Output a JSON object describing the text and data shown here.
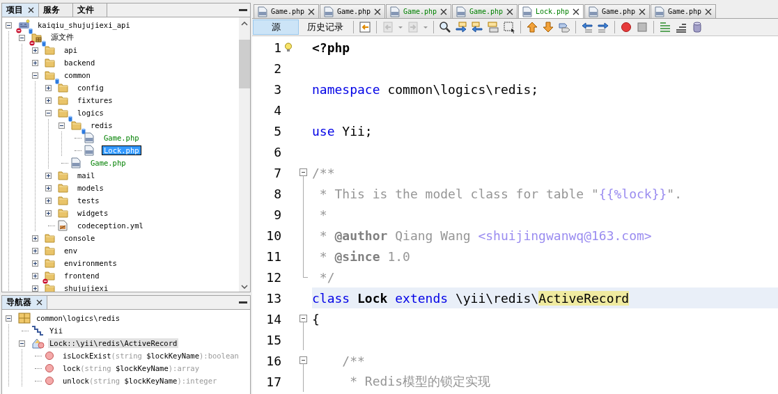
{
  "project_panel": {
    "tabs": [
      {
        "label": "项目",
        "selected": true,
        "closable": true
      },
      {
        "label": "服务",
        "selected": false,
        "closable": false
      },
      {
        "label": "文件",
        "selected": false,
        "closable": false
      }
    ],
    "tree": [
      {
        "name": "kaiqiu_shujujiexi_api",
        "kind": "project",
        "expanded": true,
        "selected": false,
        "error": true,
        "db": true,
        "children": [
          {
            "name": "源文件",
            "kind": "sources",
            "expanded": true,
            "selected": false,
            "error": true,
            "db": true,
            "children": [
              {
                "name": "api",
                "kind": "folder",
                "expanded": false,
                "selected": false,
                "error": false,
                "db": false
              },
              {
                "name": "backend",
                "kind": "folder",
                "expanded": false,
                "selected": false,
                "error": false,
                "db": false
              },
              {
                "name": "common",
                "kind": "folder",
                "expanded": true,
                "selected": false,
                "error": false,
                "db": true,
                "children": [
                  {
                    "name": "config",
                    "kind": "folder",
                    "expanded": false,
                    "selected": false,
                    "error": false,
                    "db": false
                  },
                  {
                    "name": "fixtures",
                    "kind": "folder",
                    "expanded": false,
                    "selected": false,
                    "error": false,
                    "db": false
                  },
                  {
                    "name": "logics",
                    "kind": "folder",
                    "expanded": true,
                    "selected": false,
                    "error": false,
                    "db": true,
                    "children": [
                      {
                        "name": "redis",
                        "kind": "folder",
                        "expanded": true,
                        "selected": false,
                        "error": false,
                        "db": true,
                        "children": [
                          {
                            "name": "Game.php",
                            "kind": "php",
                            "selected": false,
                            "error": false,
                            "db": false,
                            "color": "#008000"
                          },
                          {
                            "name": "Lock.php",
                            "kind": "php",
                            "selected": true,
                            "error": false,
                            "db": false
                          }
                        ]
                      },
                      {
                        "name": "Game.php",
                        "kind": "php",
                        "selected": false,
                        "error": false,
                        "db": false,
                        "color": "#008000"
                      }
                    ]
                  },
                  {
                    "name": "mail",
                    "kind": "folder",
                    "expanded": false,
                    "selected": false,
                    "error": false,
                    "db": false
                  },
                  {
                    "name": "models",
                    "kind": "folder",
                    "expanded": false,
                    "selected": false,
                    "error": false,
                    "db": false
                  },
                  {
                    "name": "tests",
                    "kind": "folder",
                    "expanded": false,
                    "selected": false,
                    "error": false,
                    "db": false
                  },
                  {
                    "name": "widgets",
                    "kind": "folder",
                    "expanded": false,
                    "selected": false,
                    "error": false,
                    "db": false
                  },
                  {
                    "name": "codeception.yml",
                    "kind": "yml",
                    "selected": false,
                    "error": false,
                    "db": false
                  }
                ]
              },
              {
                "name": "console",
                "kind": "folder",
                "expanded": false,
                "selected": false,
                "error": false,
                "db": false
              },
              {
                "name": "env",
                "kind": "folder",
                "expanded": false,
                "selected": false,
                "error": false,
                "db": false
              },
              {
                "name": "environments",
                "kind": "folder",
                "expanded": false,
                "selected": false,
                "error": false,
                "db": false
              },
              {
                "name": "frontend",
                "kind": "folder",
                "expanded": false,
                "selected": false,
                "error": true,
                "db": false
              },
              {
                "name": "shujujiexi",
                "kind": "folder",
                "expanded": false,
                "selected": false,
                "error": false,
                "db": false
              }
            ]
          }
        ]
      }
    ]
  },
  "navigator": {
    "tab": {
      "label": "导航器",
      "selected": true
    },
    "tree": [
      {
        "kind": "namespace",
        "expanded": true,
        "selected": false,
        "label": [
          {
            "t": "common\\logics\\redis",
            "kind": "plain"
          }
        ],
        "children": [
          {
            "kind": "use",
            "selected": false,
            "label": [
              {
                "t": "Yii",
                "kind": "plain"
              }
            ]
          },
          {
            "kind": "class",
            "expanded": true,
            "selected": true,
            "label": [
              {
                "t": "Lock::\\yii\\redis\\ActiveRecord",
                "kind": "plain"
              }
            ],
            "children": [
              {
                "kind": "method",
                "selected": false,
                "label": [
                  {
                    "t": "isLockExist",
                    "kind": "plain"
                  },
                  {
                    "t": "(string ",
                    "kind": "dim"
                  },
                  {
                    "t": "$lockKeyName",
                    "kind": "plain"
                  },
                  {
                    "t": "):boolean",
                    "kind": "dim"
                  }
                ]
              },
              {
                "kind": "method",
                "selected": false,
                "label": [
                  {
                    "t": "lock",
                    "kind": "plain"
                  },
                  {
                    "t": "(string ",
                    "kind": "dim"
                  },
                  {
                    "t": "$lockKeyName",
                    "kind": "plain"
                  },
                  {
                    "t": "):array",
                    "kind": "dim"
                  }
                ]
              },
              {
                "kind": "method",
                "selected": false,
                "label": [
                  {
                    "t": "unlock",
                    "kind": "plain"
                  },
                  {
                    "t": "(string ",
                    "kind": "dim"
                  },
                  {
                    "t": "$lockKeyName",
                    "kind": "plain"
                  },
                  {
                    "t": "):integer",
                    "kind": "dim"
                  }
                ]
              }
            ]
          }
        ]
      }
    ]
  },
  "editor": {
    "tabs": [
      {
        "label": "Game.php",
        "selected": false,
        "color": "#000000"
      },
      {
        "label": "Game.php",
        "selected": false,
        "color": "#000000"
      },
      {
        "label": "Game.php",
        "selected": false,
        "color": "#008000"
      },
      {
        "label": "Game.php",
        "selected": false,
        "color": "#008000"
      },
      {
        "label": "Lock.php",
        "selected": true,
        "color": "#008000"
      },
      {
        "label": "Game.php",
        "selected": false,
        "color": "#000000"
      },
      {
        "label": "Game.php",
        "selected": false,
        "color": "#000000"
      }
    ],
    "views": [
      {
        "label": "源",
        "selected": true
      },
      {
        "label": "历史记录",
        "selected": false
      }
    ],
    "toolbar": [
      {
        "kind": "last-edit",
        "disabled": false
      },
      {
        "kind": "sep"
      },
      {
        "kind": "back",
        "disabled": true
      },
      {
        "kind": "caret",
        "disabled": true
      },
      {
        "kind": "forward",
        "disabled": true
      },
      {
        "kind": "caret",
        "disabled": true
      },
      {
        "kind": "sep"
      },
      {
        "kind": "find",
        "disabled": false
      },
      {
        "kind": "prev",
        "disabled": false
      },
      {
        "kind": "next",
        "disabled": false
      },
      {
        "kind": "highlight",
        "disabled": false
      },
      {
        "kind": "select",
        "disabled": false
      },
      {
        "kind": "sep"
      },
      {
        "kind": "up",
        "disabled": false
      },
      {
        "kind": "down",
        "disabled": false
      },
      {
        "kind": "bookmark",
        "disabled": false
      },
      {
        "kind": "sep"
      },
      {
        "kind": "shift-left",
        "disabled": false
      },
      {
        "kind": "shift-right",
        "disabled": false
      },
      {
        "kind": "sep"
      },
      {
        "kind": "record",
        "disabled": false
      },
      {
        "kind": "stop",
        "disabled": false
      },
      {
        "kind": "sep"
      },
      {
        "kind": "comment",
        "disabled": false
      },
      {
        "kind": "lines",
        "disabled": false
      },
      {
        "kind": "database",
        "disabled": false
      }
    ],
    "lines": [
      {
        "number": "1",
        "hint": true,
        "current": false,
        "kind": "plain",
        "tokens": [
          {
            "t": "<?php",
            "kind": "phptag"
          }
        ]
      },
      {
        "number": "2",
        "hint": false,
        "current": false,
        "kind": "plain"
      },
      {
        "number": "3",
        "hint": false,
        "current": false,
        "kind": "plain",
        "tokens": [
          {
            "t": "namespace",
            "kind": "kw"
          },
          {
            "t": " common\\logics\\redis;",
            "kind": "plain"
          }
        ]
      },
      {
        "number": "4",
        "hint": false,
        "current": false,
        "kind": "plain"
      },
      {
        "number": "5",
        "hint": false,
        "current": false,
        "kind": "plain",
        "tokens": [
          {
            "t": "use",
            "kind": "kw"
          },
          {
            "t": " Yii;",
            "kind": "plain"
          }
        ]
      },
      {
        "number": "6",
        "hint": false,
        "current": false,
        "kind": "plain"
      },
      {
        "number": "7",
        "hint": false,
        "current": false,
        "kind": "fold-start",
        "tokens": [
          {
            "t": "/**",
            "kind": "comment"
          }
        ]
      },
      {
        "number": "8",
        "hint": false,
        "current": false,
        "kind": "fold-body",
        "tokens": [
          {
            "t": " * This is the model class for table \"",
            "kind": "comment"
          },
          {
            "t": "{{%lock}}",
            "kind": "string"
          },
          {
            "t": "\".",
            "kind": "comment"
          }
        ]
      },
      {
        "number": "9",
        "hint": false,
        "current": false,
        "kind": "fold-body",
        "tokens": [
          {
            "t": " *",
            "kind": "comment"
          }
        ]
      },
      {
        "number": "10",
        "hint": false,
        "current": false,
        "kind": "fold-body",
        "tokens": [
          {
            "t": " * ",
            "kind": "comment"
          },
          {
            "t": "@author",
            "kind": "doctag"
          },
          {
            "t": " Qiang Wang ",
            "kind": "comment"
          },
          {
            "t": "<shuijingwanwq@163.com>",
            "kind": "string"
          }
        ]
      },
      {
        "number": "11",
        "hint": false,
        "current": false,
        "kind": "fold-body",
        "tokens": [
          {
            "t": " * ",
            "kind": "comment"
          },
          {
            "t": "@since",
            "kind": "doctag"
          },
          {
            "t": " 1.0",
            "kind": "comment"
          }
        ]
      },
      {
        "number": "12",
        "hint": false,
        "current": false,
        "kind": "fold-end",
        "tokens": [
          {
            "t": " */",
            "kind": "comment"
          }
        ]
      },
      {
        "number": "13",
        "hint": false,
        "current": true,
        "kind": "plain",
        "tokens": [
          {
            "t": "class",
            "kind": "kw"
          },
          {
            "t": " Lock ",
            "kind": "bold"
          },
          {
            "t": "extends",
            "kind": "kw"
          },
          {
            "t": " \\yii\\redis\\",
            "kind": "plain"
          },
          {
            "t": "ActiveRecord",
            "kind": "mark"
          }
        ]
      },
      {
        "number": "14",
        "hint": false,
        "current": false,
        "kind": "fold-start",
        "tokens": [
          {
            "t": "{",
            "kind": "plain"
          }
        ]
      },
      {
        "number": "15",
        "hint": false,
        "current": false,
        "kind": "fold-body"
      },
      {
        "number": "16",
        "hint": false,
        "current": false,
        "kind": "fold-start",
        "tokens": [
          {
            "t": "    /**",
            "kind": "comment"
          }
        ]
      },
      {
        "number": "17",
        "hint": false,
        "current": false,
        "kind": "fold-body",
        "tokens": [
          {
            "t": "     * Redis模型的锁定实现",
            "kind": "comment"
          }
        ]
      }
    ]
  }
}
